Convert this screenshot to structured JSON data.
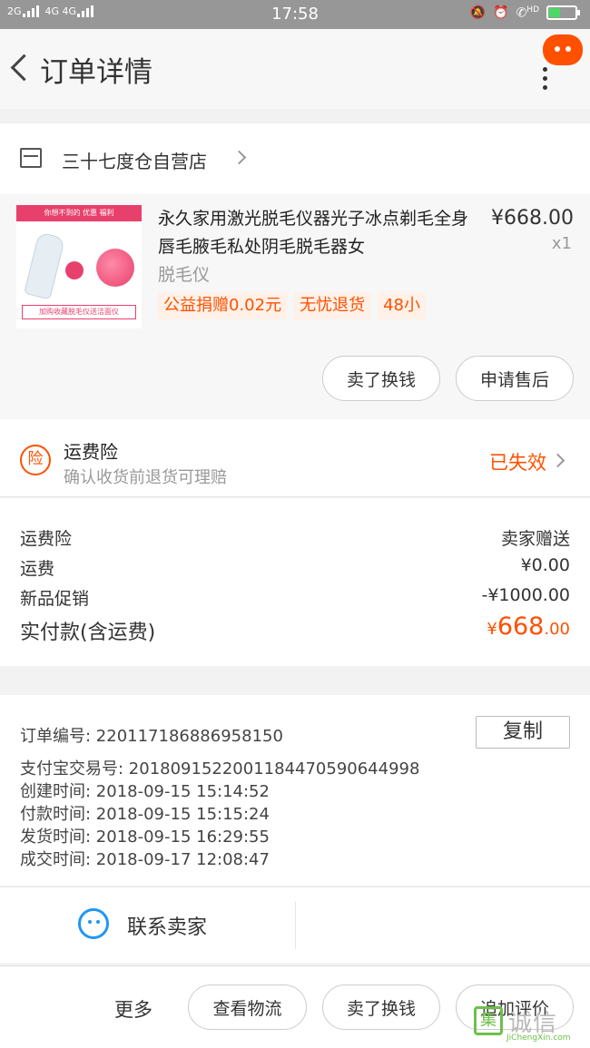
{
  "status_bar": {
    "signal_left": "2G",
    "signal_right": "4G 4G",
    "time": "17:58",
    "hd": "HD"
  },
  "header": {
    "title": "订单详情"
  },
  "shop": {
    "name": "三十七度仓自营店"
  },
  "product": {
    "title": "永久家用激光脱毛仪器光子冰点剃毛全身唇毛腋毛私处阴毛脱毛器女",
    "sku": "脱毛仪",
    "price": "¥668.00",
    "quantity": "x1",
    "tags": [
      "公益捐赠0.02元",
      "无忧退货",
      "48小"
    ],
    "thumb_banner": "你想不到的 优惠 福利",
    "thumb_footer": "加购收藏脱毛仪送洁面仪",
    "actions": {
      "sell_label": "卖了换钱",
      "after_sale_label": "申请售后"
    }
  },
  "insurance": {
    "icon_text": "险",
    "title": "运费险",
    "subtitle": "确认收货前退货可理赔",
    "status": "已失效"
  },
  "fees": {
    "rows": [
      {
        "label": "运费险",
        "value": "卖家赠送"
      },
      {
        "label": "运费",
        "value": "¥0.00"
      },
      {
        "label": "新品促销",
        "value": "-¥1000.00"
      }
    ],
    "total_label": "实付款(含运费)",
    "total_currency": "¥",
    "total_integer": "668",
    "total_decimal": ".00"
  },
  "order_info": {
    "order_no": "订单编号:   220117186886958150",
    "alipay_no": "支付宝交易号:   2018091522001184470590644998",
    "created": "创建时间:   2018-09-15  15:14:52",
    "paid": "付款时间:   2018-09-15  15:15:24",
    "shipped": "发货时间:   2018-09-15  16:29:55",
    "completed": "成交时间:   2018-09-17  12:08:47",
    "copy_label": "复制"
  },
  "contact": {
    "label": "联系卖家"
  },
  "bottom_bar": {
    "more_label": "更多",
    "logistics_label": "查看物流",
    "sell_label": "卖了换钱",
    "review_label": "追加评价"
  },
  "watermark": {
    "text": "诚信",
    "box": "集",
    "sub": "JiChengXin.com"
  },
  "colors": {
    "accent": "#ff5000",
    "status_bar": "#979797",
    "blue": "#2196f3"
  }
}
